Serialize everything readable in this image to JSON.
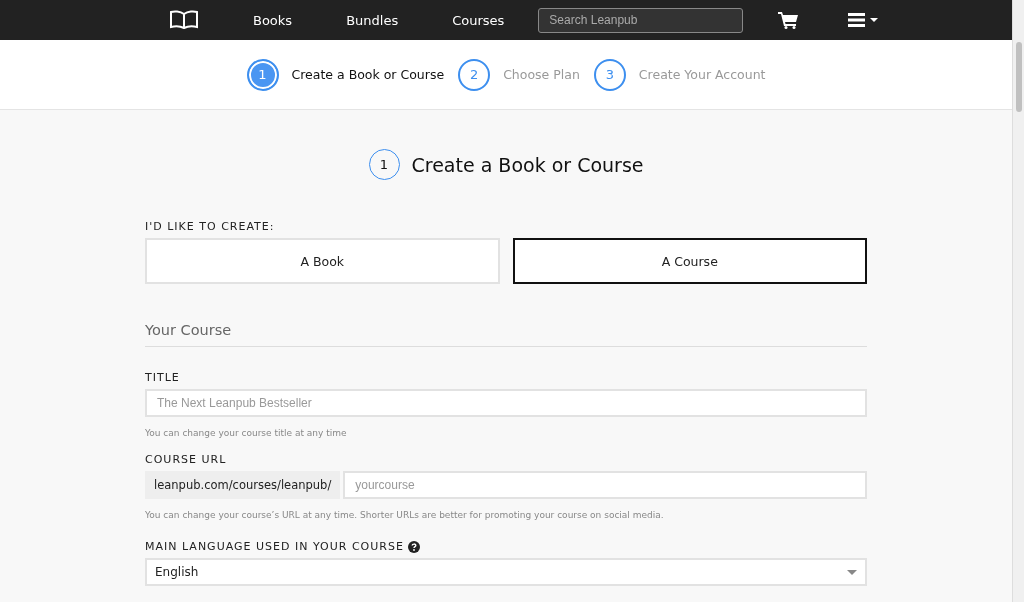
{
  "nav": {
    "links": [
      "Books",
      "Bundles",
      "Courses"
    ],
    "search": {
      "placeholder": "Search Leanpub"
    }
  },
  "steps": [
    {
      "number": "1",
      "label": "Create a Book or Course",
      "selected": true
    },
    {
      "number": "2",
      "label": "Choose Plan",
      "selected": false
    },
    {
      "number": "3",
      "label": "Create Your Account",
      "selected": false
    }
  ],
  "heading": {
    "number": "1",
    "title": "Create a Book or Course"
  },
  "create": {
    "label": "I'D LIKE TO CREATE:",
    "options": [
      {
        "label": "A Book",
        "selected": false
      },
      {
        "label": "A Course",
        "selected": true
      }
    ]
  },
  "section_title": "Your Course",
  "title_field": {
    "label": "TITLE",
    "placeholder": "The Next Leanpub Bestseller",
    "help": "You can change your course title at any time"
  },
  "url_field": {
    "label": "COURSE URL",
    "prefix": "leanpub.com/courses/leanpub/",
    "placeholder": "yourcourse",
    "help": "You can change your course’s URL at any time. Shorter URLs are better for promoting your course on social media."
  },
  "language_field": {
    "label": "MAIN LANGUAGE USED IN YOUR COURSE",
    "value": "English"
  }
}
